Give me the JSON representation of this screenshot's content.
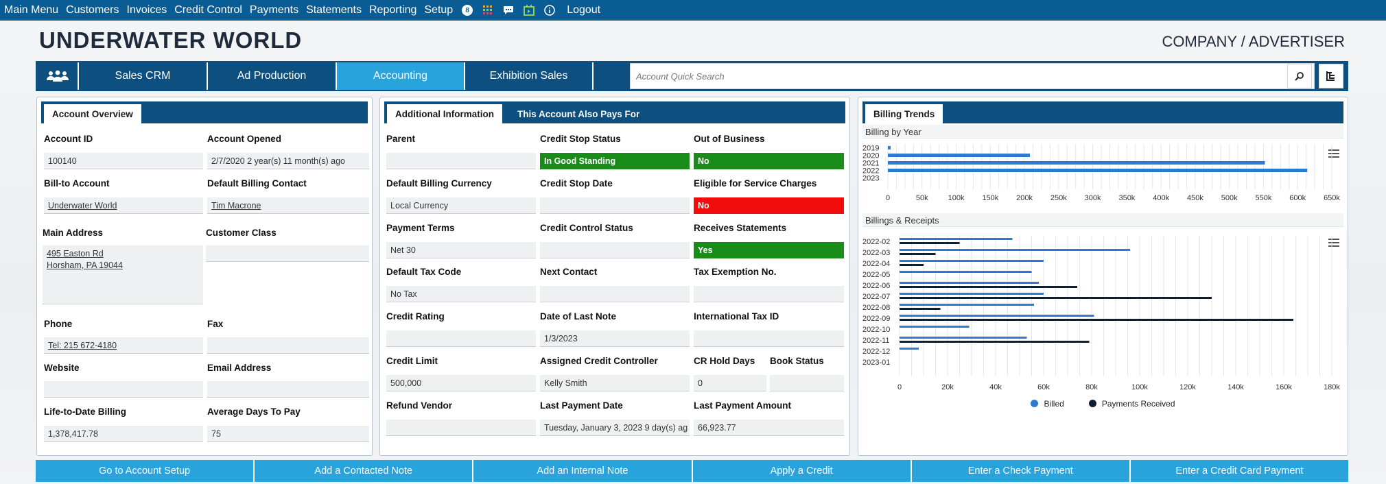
{
  "topnav": {
    "items": [
      "Main Menu",
      "Customers",
      "Invoices",
      "Credit Control",
      "Payments",
      "Statements",
      "Reporting",
      "Setup"
    ],
    "badge": "8",
    "logout": "Logout"
  },
  "header": {
    "title": "UNDERWATER WORLD",
    "subtitle": "COMPANY / ADVERTISER"
  },
  "tabs": [
    "Sales CRM",
    "Ad Production",
    "Accounting",
    "Exhibition Sales"
  ],
  "active_tab": "Accounting",
  "search": {
    "placeholder": "Account Quick Search"
  },
  "overview": {
    "tab": "Account Overview",
    "account_id_label": "Account ID",
    "account_id": "100140",
    "opened_label": "Account Opened",
    "opened": "2/7/2020 2 year(s) 11 month(s) ago",
    "billto_label": "Bill-to Account",
    "billto": "Underwater World",
    "contact_label": "Default Billing Contact",
    "contact": "Tim Macrone",
    "address_label": "Main Address",
    "address_line1": "495 Easton Rd",
    "address_line2": "Horsham, PA 19044",
    "class_label": "Customer Class",
    "class": "",
    "phone_label": "Phone",
    "phone": "Tel: 215 672-4180",
    "fax_label": "Fax",
    "fax": "",
    "website_label": "Website",
    "website": "",
    "email_label": "Email Address",
    "email": "",
    "ltd_label": "Life-to-Date Billing",
    "ltd": "1,378,417.78",
    "avgdays_label": "Average Days To Pay",
    "avgdays": "75"
  },
  "additional": {
    "tab1": "Additional Information",
    "tab2": "This Account Also Pays For",
    "parent_label": "Parent",
    "parent": "",
    "cstop_label": "Credit Stop Status",
    "cstop": "In Good Standing",
    "oob_label": "Out of Business",
    "oob": "No",
    "currency_label": "Default Billing Currency",
    "currency": "Local Currency",
    "cstopdate_label": "Credit Stop Date",
    "cstopdate": "",
    "eligible_label": "Eligible for Service Charges",
    "eligible": "No",
    "terms_label": "Payment Terms",
    "terms": "Net 30",
    "ccstatus_label": "Credit Control Status",
    "ccstatus": "",
    "statements_label": "Receives Statements",
    "statements": "Yes",
    "tax_label": "Default Tax Code",
    "tax": "No Tax",
    "nextcontact_label": "Next Contact",
    "nextcontact": "",
    "taxex_label": "Tax Exemption No.",
    "taxex": "",
    "rating_label": "Credit Rating",
    "rating": "",
    "lastnote_label": "Date of Last Note",
    "lastnote": "1/3/2023",
    "intltax_label": "International Tax ID",
    "intltax": "",
    "limit_label": "Credit Limit",
    "limit": "500,000",
    "controller_label": "Assigned Credit Controller",
    "controller": "Kelly Smith",
    "crhold_label": "CR Hold Days",
    "crhold": "0",
    "book_label": "Book Status",
    "book": "",
    "refund_label": "Refund Vendor",
    "refund": "",
    "lastpay_label": "Last Payment Date",
    "lastpay": "Tuesday, January 3, 2023 9 day(s) ag",
    "lastamt_label": "Last Payment Amount",
    "lastamt": "66,923.77"
  },
  "trends": {
    "tab": "Billing Trends",
    "section1": "Billing by Year",
    "section2": "Billings & Receipts"
  },
  "chart_data": [
    {
      "type": "bar",
      "orientation": "horizontal",
      "categories": [
        "2019",
        "2020",
        "2021",
        "2022",
        "2023"
      ],
      "values": [
        4000,
        208000,
        552000,
        614000,
        0
      ],
      "xlim": [
        0,
        650000
      ],
      "xticks": [
        "0",
        "50k",
        "100k",
        "150k",
        "200k",
        "250k",
        "300k",
        "350k",
        "400k",
        "450k",
        "500k",
        "550k",
        "600k",
        "650k"
      ],
      "color": "#2e7ad1",
      "grid": true
    },
    {
      "type": "bar",
      "orientation": "horizontal",
      "categories": [
        "2022-02",
        "2022-03",
        "2022-04",
        "2022-05",
        "2022-06",
        "2022-07",
        "2022-08",
        "2022-09",
        "2022-10",
        "2022-11",
        "2022-12",
        "2023-01"
      ],
      "series": [
        {
          "name": "Billed",
          "color": "#2e7ad1",
          "values": [
            47000,
            96000,
            60000,
            55000,
            58000,
            60000,
            56000,
            81000,
            29000,
            53000,
            8000,
            0
          ]
        },
        {
          "name": "Payments Received",
          "color": "#0f1e33",
          "values": [
            25000,
            15000,
            10000,
            0,
            74000,
            130000,
            17000,
            164000,
            0,
            79000,
            0,
            0
          ]
        }
      ],
      "xlim": [
        0,
        180000
      ],
      "xticks": [
        "0",
        "20k",
        "40k",
        "60k",
        "80k",
        "100k",
        "120k",
        "140k",
        "160k",
        "180k"
      ],
      "legend": "bottom",
      "grid": true
    }
  ],
  "bottom_buttons": [
    "Go to Account Setup",
    "Add a Contacted Note",
    "Add an Internal Note",
    "Apply a Credit",
    "Enter a Check Payment",
    "Enter a Credit Card Payment"
  ]
}
